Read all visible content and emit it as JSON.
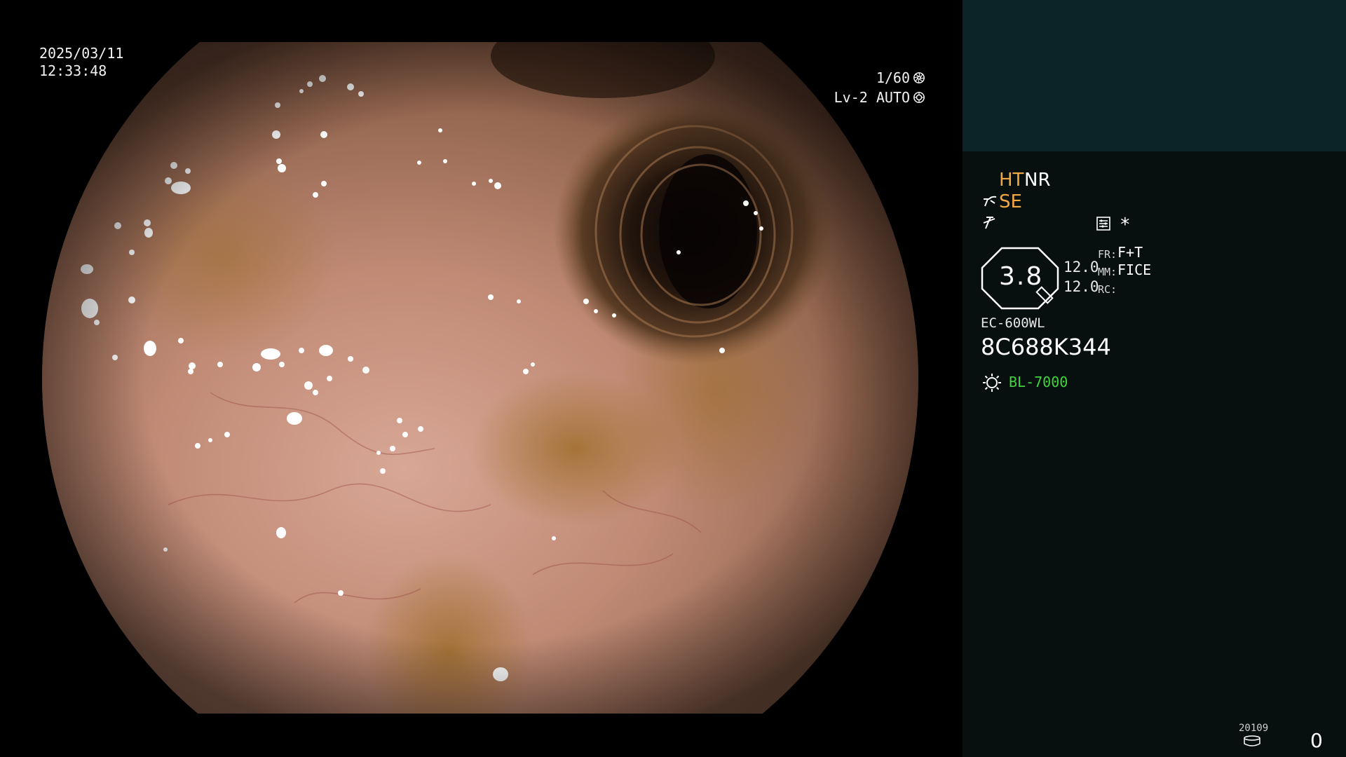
{
  "video": {
    "date": "2025/03/11",
    "time": "12:33:48",
    "shutter": "1/60",
    "shutter_icon": "aperture-icon",
    "level": "Lv-2 AUTO",
    "level_icon": "iris-icon"
  },
  "panel": {
    "modes": {
      "ht": "HT",
      "nr": "NR",
      "se": "SE",
      "asterisk": "*"
    },
    "magnification": "3.8",
    "values": [
      "12.0",
      "12.0"
    ],
    "fr_key": "FR:",
    "fr_val": "F+T",
    "mm_key": "MM:",
    "mm_val": "FICE",
    "rc_key": "RC:",
    "scope_model": "EC-600WL",
    "scope_serial": "8C688K344",
    "light_source": "BL-7000",
    "counter_label": "20109",
    "counter_value": "0"
  },
  "colors": {
    "accent_orange": "#f2a842",
    "light_green": "#3ed43a",
    "panel_top": "#0c2428",
    "panel_bg": "#07100f"
  }
}
